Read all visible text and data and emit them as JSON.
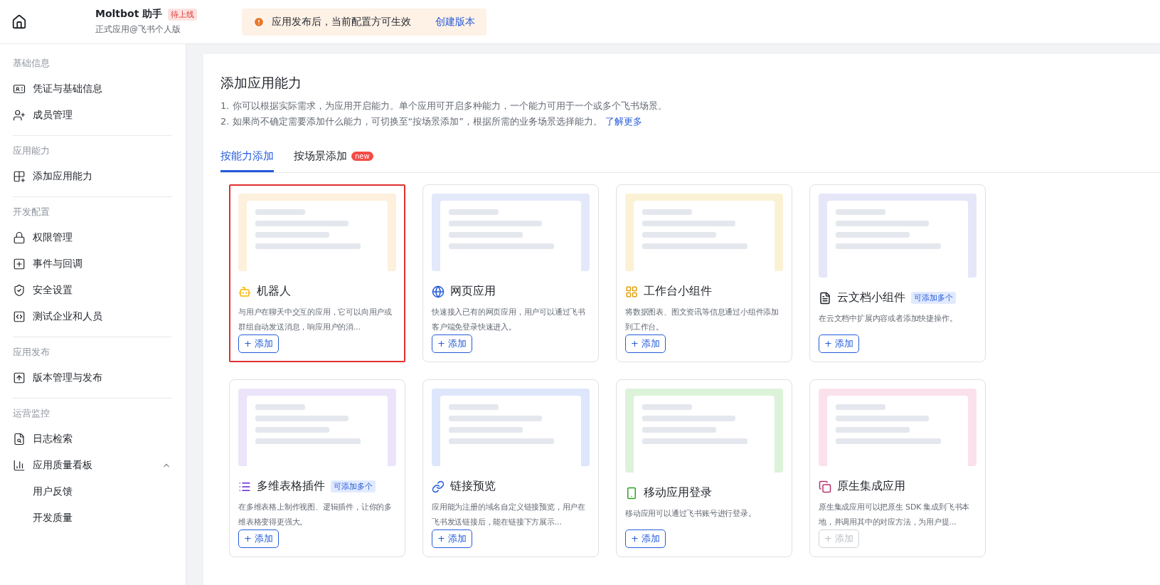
{
  "header": {
    "app_name": "Moltbot 助手",
    "status_badge": "待上线",
    "subtitle": "正式应用@飞书个人版",
    "notice": "应用发布后，当前配置方可生效",
    "notice_action": "创建版本"
  },
  "sidebar": {
    "sections": [
      {
        "title": "基础信息",
        "items": [
          {
            "label": "凭证与基础信息"
          },
          {
            "label": "成员管理"
          }
        ]
      },
      {
        "title": "应用能力",
        "items": [
          {
            "label": "添加应用能力"
          }
        ]
      },
      {
        "title": "开发配置",
        "items": [
          {
            "label": "权限管理"
          },
          {
            "label": "事件与回调"
          },
          {
            "label": "安全设置"
          },
          {
            "label": "测试企业和人员"
          }
        ]
      },
      {
        "title": "应用发布",
        "items": [
          {
            "label": "版本管理与发布"
          }
        ]
      },
      {
        "title": "运营监控",
        "items": [
          {
            "label": "日志检索"
          },
          {
            "label": "应用质量看板",
            "expanded": true,
            "children": [
              {
                "label": "用户反馈"
              },
              {
                "label": "开发质量"
              }
            ]
          }
        ]
      }
    ]
  },
  "main": {
    "title": "添加应用能力",
    "notes": [
      "1. 你可以根据实际需求，为应用开启能力。单个应用可开启多种能力，一个能力可用于一个或多个飞书场景。",
      "2. 如果尚不确定需要添加什么能力，可切换至“按场景添加”，根据所需的业务场景选择能力。"
    ],
    "learn_more": "了解更多",
    "tabs": [
      {
        "label": "按能力添加",
        "selected": true
      },
      {
        "label": "按场景添加",
        "selected": false,
        "badge": "new"
      }
    ],
    "cards": [
      {
        "title": "机器人",
        "description": "与用户在聊天中交互的应用，它可以向用户或群组自动发送消息，响应用户的消...",
        "button": "+ 添加",
        "selected": true,
        "disabled": false
      },
      {
        "title": "网页应用",
        "description": "快速接入已有的网页应用，用户可以通过飞书客户端免登录快速进入。",
        "button": "+ 添加",
        "selected": false,
        "disabled": false
      },
      {
        "title": "工作台小组件",
        "description": "将数据图表、图文资讯等信息通过小组件添加到工作台。",
        "button": "+ 添加",
        "selected": false,
        "disabled": false
      },
      {
        "title": "云文档小组件",
        "badge": "可添加多个",
        "description": "在云文档中扩展内容或者添加快捷操作。",
        "button": "+ 添加",
        "selected": false,
        "disabled": false
      },
      {
        "title": "多维表格插件",
        "badge": "可添加多个",
        "description": "在多维表格上制作视图、逻辑插件，让你的多维表格变得更强大。",
        "button": "+ 添加",
        "selected": false,
        "disabled": false
      },
      {
        "title": "链接预览",
        "description": "应用能为注册的域名自定义链接预览，用户在飞书发送链接后，能在链接下方展示...",
        "button": "+ 添加",
        "selected": false,
        "disabled": false
      },
      {
        "title": "移动应用登录",
        "description": "移动应用可以通过飞书账号进行登录。",
        "button": "+ 添加",
        "selected": false,
        "disabled": false
      },
      {
        "title": "原生集成应用",
        "description": "原生集成应用可以把原生 SDK 集成到飞书本地，并调用其中的对应方法，为用户提...",
        "button": "+ 添加",
        "selected": false,
        "disabled": true
      }
    ]
  }
}
